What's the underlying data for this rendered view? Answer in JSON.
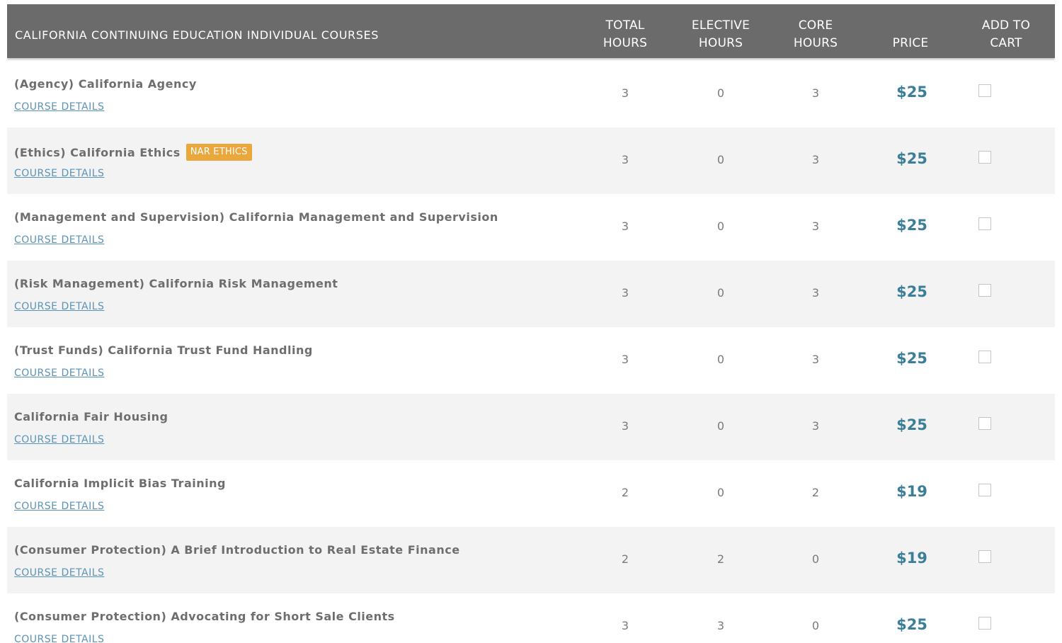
{
  "table": {
    "title": "CALIFORNIA CONTINUING EDUCATION INDIVIDUAL COURSES",
    "columns": {
      "total_hours": [
        "TOTAL",
        "HOURS"
      ],
      "elective_hours": [
        "ELECTIVE",
        "HOURS"
      ],
      "core_hours": [
        "CORE",
        "HOURS"
      ],
      "price": [
        "PRICE"
      ],
      "add_to_cart": [
        "ADD TO",
        "CART"
      ]
    },
    "details_label": "COURSE DETAILS",
    "rows": [
      {
        "name": "(Agency) California Agency",
        "badge": "",
        "total": "3",
        "elective": "0",
        "core": "3",
        "price": "$25"
      },
      {
        "name": "(Ethics) California Ethics",
        "badge": "NAR ETHICS",
        "total": "3",
        "elective": "0",
        "core": "3",
        "price": "$25"
      },
      {
        "name": "(Management and Supervision) California Management and Supervision",
        "badge": "",
        "total": "3",
        "elective": "0",
        "core": "3",
        "price": "$25"
      },
      {
        "name": "(Risk Management) California Risk Management",
        "badge": "",
        "total": "3",
        "elective": "0",
        "core": "3",
        "price": "$25"
      },
      {
        "name": "(Trust Funds) California Trust Fund Handling",
        "badge": "",
        "total": "3",
        "elective": "0",
        "core": "3",
        "price": "$25"
      },
      {
        "name": "California Fair Housing",
        "badge": "",
        "total": "3",
        "elective": "0",
        "core": "3",
        "price": "$25"
      },
      {
        "name": "California Implicit Bias Training",
        "badge": "",
        "total": "2",
        "elective": "0",
        "core": "2",
        "price": "$19"
      },
      {
        "name": "(Consumer Protection) A Brief Introduction to Real Estate Finance",
        "badge": "",
        "total": "2",
        "elective": "2",
        "core": "0",
        "price": "$19"
      },
      {
        "name": "(Consumer Protection) Advocating for Short Sale Clients",
        "badge": "",
        "total": "3",
        "elective": "3",
        "core": "0",
        "price": "$25"
      }
    ]
  },
  "colors": {
    "header_bg": "#6c6b6c",
    "price": "#3b7e98",
    "link": "#5a93b8",
    "badge": "#e9a73c",
    "row_alt": "#f3f3f3"
  }
}
